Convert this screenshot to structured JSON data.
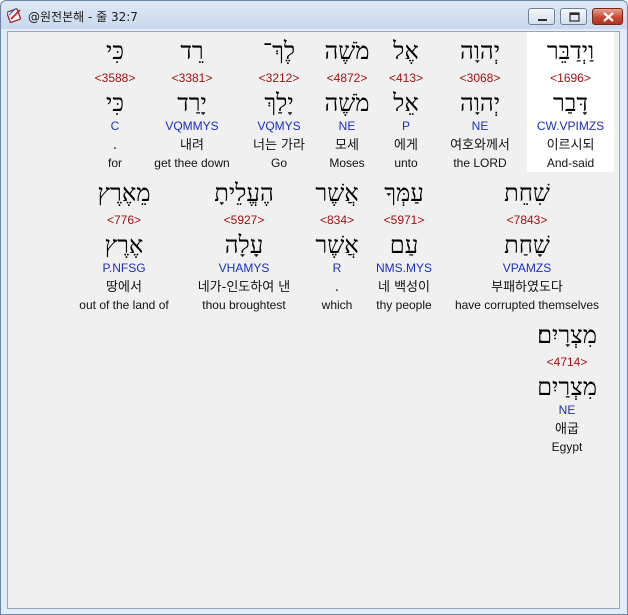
{
  "window": {
    "title": "@원전본해 - 줄 32:7",
    "icons": {
      "app": "bible-app-icon",
      "minimize": "minimize-icon",
      "maximize": "maximize-icon",
      "close": "close-icon"
    }
  },
  "colors": {
    "strong_number": "#a21010",
    "morphology": "#1a2fbf",
    "highlight_background": "#ffffff",
    "panel_background": "#f0f0f0",
    "close_button": "#c74a35"
  },
  "rows": [
    {
      "words": [
        {
          "hebrew_inflected": "וַיְדַבֵּר",
          "strong": "<1696>",
          "hebrew_lemma": "דָּבַר",
          "morph": "CW.VPIMZS",
          "korean": "이르시되",
          "english": "And-said",
          "highlighted": true
        },
        {
          "hebrew_inflected": "יְהוָה",
          "strong": "<3068>",
          "hebrew_lemma": "יְהוָה",
          "morph": "NE",
          "korean": "여호와께서",
          "english": "the LORD"
        },
        {
          "hebrew_inflected": "אֶל",
          "strong": "<413>",
          "hebrew_lemma": "אֵל",
          "morph": "P",
          "korean": "에게",
          "english": "unto"
        },
        {
          "hebrew_inflected": "מֹשֶׁה",
          "strong": "<4872>",
          "hebrew_lemma": "מֹשֶׁה",
          "morph": "NE",
          "korean": "모세",
          "english": "Moses"
        },
        {
          "hebrew_inflected": "לֶךְ־",
          "strong": "<3212>",
          "hebrew_lemma": "יָלַךְ",
          "morph": "VQMYS",
          "korean": "너는 가라",
          "english": "Go"
        },
        {
          "hebrew_inflected": "רֵד",
          "strong": "<3381>",
          "hebrew_lemma": "יָרַד",
          "morph": "VQMMYS",
          "korean": "내려",
          "english": "get thee down"
        },
        {
          "hebrew_inflected": "כִּי",
          "strong": "<3588>",
          "hebrew_lemma": "כִּי",
          "morph": "C",
          "korean": ".",
          "english": "for"
        }
      ]
    },
    {
      "words": [
        {
          "hebrew_inflected": "שִׁחֵת",
          "strong": "<7843>",
          "hebrew_lemma": "שָׁחַת",
          "morph": "VPAMZS",
          "korean": "부패하였도다",
          "english": "have corrupted themselves"
        },
        {
          "hebrew_inflected": "עַמְּךָ",
          "strong": "<5971>",
          "hebrew_lemma": "עַם",
          "morph": "NMS.MYS",
          "korean": "네 백성이",
          "english": "thy people"
        },
        {
          "hebrew_inflected": "אֲשֶׁר",
          "strong": "<834>",
          "hebrew_lemma": "אֲשֶׁר",
          "morph": "R",
          "korean": ".",
          "english": "which"
        },
        {
          "hebrew_inflected": "הֶעֱלֵיתָ",
          "strong": "<5927>",
          "hebrew_lemma": "עָלָה",
          "morph": "VHAMYS",
          "korean": "네가-인도하여 낸",
          "english": "thou broughtest"
        },
        {
          "hebrew_inflected": "מֵאֶרֶץ",
          "strong": "<776>",
          "hebrew_lemma": "אֶרֶץ",
          "morph": "P.NFSG",
          "korean": "땅에서",
          "english": "out of the land of"
        }
      ]
    },
    {
      "words": [
        {
          "hebrew_inflected": "מִצְרָיִם׃",
          "strong": "<4714>",
          "hebrew_lemma": "מִצְרַיִם",
          "morph": "NE",
          "korean": "애굽",
          "english": "Egypt"
        }
      ]
    }
  ]
}
